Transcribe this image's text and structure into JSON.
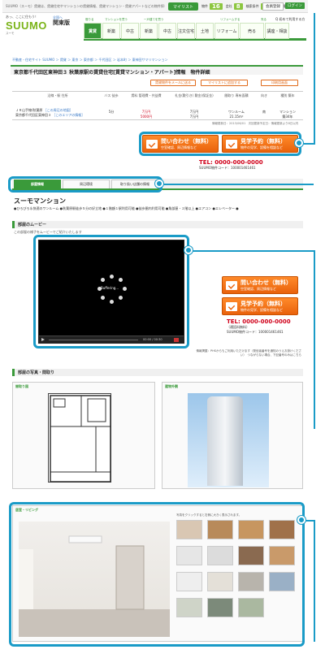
{
  "topbar": {
    "tagline": "SUUMO（スーモ）賃貸は、賃貸住宅やマンションの賃貸情報、賃貸マンション・賃貸アパートなどの物件探しをサポートする住宅情報サイトです。",
    "mylist_label": "マイリスト",
    "counts": [
      {
        "label": "物件",
        "value": "16"
      },
      {
        "label": "会社",
        "value": "8"
      },
      {
        "label": "検索条件",
        "value": "10"
      },
      {
        "label": "閲覧履歴",
        "value": ""
      }
    ],
    "register_label": "会員登録",
    "login_label": "ログイン"
  },
  "header": {
    "logo_catch": "あっ、ここに住もう！",
    "logo_name": "SUUMO",
    "logo_sub": "スーモ",
    "region_sub": "全国へ",
    "region": "関東版",
    "help": "Q 初めて利用する方",
    "nav_groups": [
      "借りる",
      "マンションを買う",
      "一戸建てを買う",
      "リフォームする",
      "売る"
    ],
    "nav_tabs": [
      "賃貸",
      "新築",
      "中古",
      "新築",
      "中古",
      "注文住宅",
      "土地",
      "リフォーム",
      "売る",
      "講座・相談"
    ],
    "active_tab": 0
  },
  "breadcrumb": "不動産・住宅サイト SUUMO ＞ 賃貸 ＞ 東京 ＞ 東京都 ＞ 千代田区 ＞ 岩本町 ＞ 東神田サマリマンション",
  "page_title": "東京都千代田区東神田３ 秋葉原駅の賃貸住宅[賃貸マンション・アパート]情報　物件詳細",
  "actions": [
    "賃貸物件をメールに送る",
    "マイリストに追加する",
    "印刷用画面"
  ],
  "info": {
    "headers": [
      "沿線・駅\n住所",
      "バス\n徒歩",
      "賃料\n管理費・共益費",
      "礼金(敷引き)\n敷金(保証金)",
      "間取り\n専有面積",
      "向き",
      "種別\n築年"
    ],
    "station": "ＪＲ山手線/秋葉原",
    "station_link": "［この周辺の地図］",
    "address": "東京都千代田区東神田３",
    "address_link": "［このエリアの情報］",
    "walk": "5分",
    "rent": "7万円",
    "fee": "5000円",
    "key_money": "7万円",
    "deposit": "7万円",
    "layout": "ワンルーム",
    "area": "21.15m²",
    "direction": "南",
    "type": "マンション",
    "age": "築34年"
  },
  "updated": "情報更新日：2013/06/01　次回更新予定日：情報更新より8日以内",
  "cta": {
    "inquiry": "問い合わせ（無料）",
    "inquiry_sub": "空室確認、周辺情報など",
    "visit": "見学予約（無料）",
    "visit_sub": "物件の見学、設備を相談など",
    "tel": "TEL: 0000-000-0000",
    "tel_note": "（通話料無料）",
    "code": "SUUMO物件コード：100001461461"
  },
  "tabs": [
    "部屋情報",
    "周辺環境",
    "取り扱い店舗の情報"
  ],
  "active_detail_tab": 0,
  "property_name": "スーモマンション",
  "features": "●ひろびろ＆快適のワンルーム ●秋葉原駅徒歩５分の好立地 ●１階額１駅利用可能 ●徒歩圏内利用可能 ●角部屋・２階以上 ●エアコン ●エレベーター ●",
  "sections": {
    "movie": "部屋のムービー",
    "photos": "部屋の写真・間取り",
    "floorplan": "間取り図",
    "exterior": "建物外観",
    "living": "居室・リビング"
  },
  "movie_note": "この部屋の様子をムービーでご紹介いたします",
  "video": {
    "buffering": "Buffering...",
    "time": "00:00 / 00:30"
  },
  "notice": "情報掲載：PHSからもご利用いただけます（発信者番号を通知のうえお掛けください）　つながらない場合、下記番号のみはこちら",
  "thumbs_note": "写真をクリックすると右側に大きく表示されます。",
  "colors": {
    "brand_green": "#3a9a3a",
    "accent_orange": "#e9620c",
    "callout_blue": "#1a9bc7",
    "tel_red": "#d0021b"
  }
}
